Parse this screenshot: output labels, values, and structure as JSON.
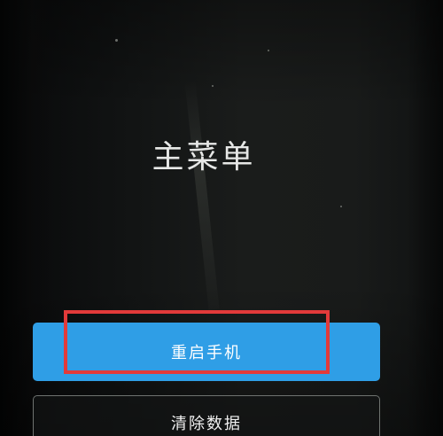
{
  "main_menu": {
    "title": "主菜单",
    "buttons": [
      {
        "label": "重启手机"
      },
      {
        "label": "清除数据"
      }
    ]
  },
  "colors": {
    "primary_button": "#2f9ee6",
    "highlight_outline": "#e23a3a",
    "background": "#161817"
  }
}
